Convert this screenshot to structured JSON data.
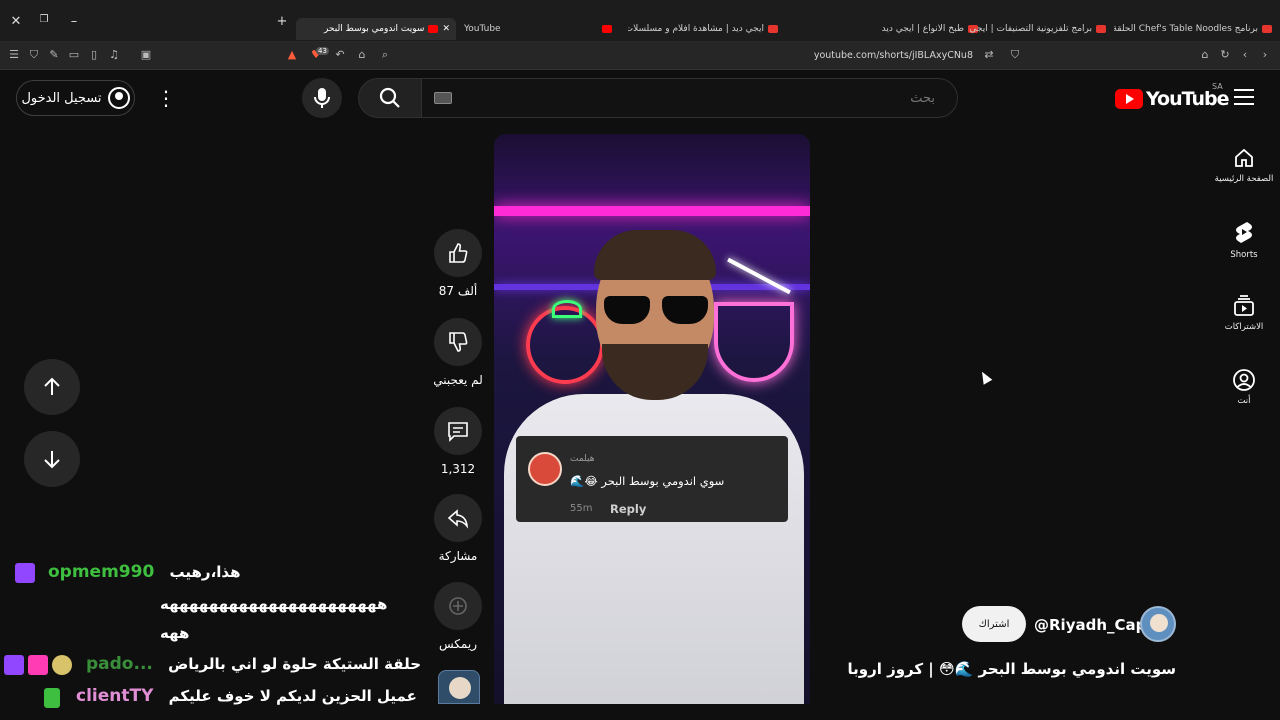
{
  "browser": {
    "tabs": [
      {
        "label": "سويت اندومي بوسط البحر",
        "active": true
      },
      {
        "label": "YouTube",
        "active": false
      },
      {
        "label": "ايجي ديد | مشاهدة افلام و مسلسلات و",
        "active": false
      },
      {
        "label": "طبخ الانواع | ايجي ديد",
        "active": false
      },
      {
        "label": "برامج تلفزيونية التصنيفات | ايجي ديد",
        "active": false
      },
      {
        "label": "برنامج Chef's Table Noodles الحلقة 4",
        "active": false
      }
    ],
    "url": "youtube.com/shorts/jIBLAxyCNu8",
    "badge_count": "43"
  },
  "header": {
    "signin_label": "تسجيل الدخول",
    "search_placeholder": "بحث",
    "logo_text": "YouTube",
    "country_code": "SA"
  },
  "guide": [
    {
      "label": "الصفحة الرئيسية",
      "icon": "home-icon"
    },
    {
      "label": "Shorts",
      "icon": "shorts-icon"
    },
    {
      "label": "الاشتراكات",
      "icon": "subscriptions-icon"
    },
    {
      "label": "أنت",
      "icon": "you-icon"
    }
  ],
  "actions": {
    "like_count": "87 ألف",
    "dislike_label": "لم يعجبني",
    "comment_count": "1,312",
    "share_label": "مشاركة",
    "remix_label": "ريمكس"
  },
  "comment_overlay": {
    "author": "هيلمت",
    "text": "سوي اندومي بوسط البحر 😂🌊",
    "time": "55m",
    "reply_label": "Reply"
  },
  "channel": {
    "handle": "@Riyadh_Cap",
    "subscribe_label": "اشتراك",
    "video_title": "سويت اندومي بوسط البحر 🌊😳 | كروز اروبا"
  },
  "chat": [
    {
      "user": "opmem990",
      "message": "هذا،رهيب",
      "color": "#3fbf3f"
    },
    {
      "user": "",
      "message": "ههههههههههههههههههههههه",
      "color": "#ffffff"
    },
    {
      "user": "",
      "message": "ههه",
      "color": "#ffffff"
    },
    {
      "user": "pado...",
      "message": "حلقة الستيكة حلوة لو اني بالرياض",
      "color": "#3a8f3a"
    },
    {
      "user": "clientTY",
      "message": "عميل الحزين لديكم لا خوف عليكم",
      "color": "#e08fd5"
    }
  ],
  "colors": {
    "background": "#0f0f0f",
    "youtube_red": "#ff0000",
    "twitch_purple": "#9146ff"
  }
}
